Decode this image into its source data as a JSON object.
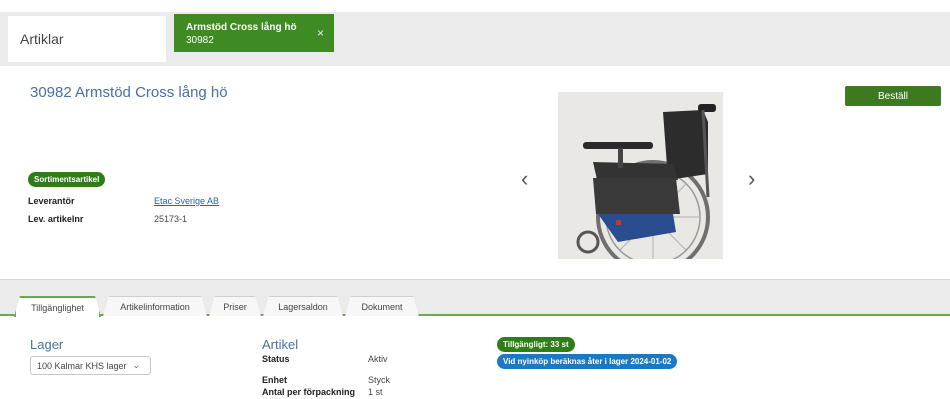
{
  "top_tabs": {
    "plain_label": "Artiklar",
    "active": {
      "title": "Armstöd Cross lång hö",
      "number": "30982",
      "close": "×"
    }
  },
  "product": {
    "title": "30982 Armstöd Cross lång hö",
    "order_button": "Beställ",
    "badge": "Sortimentsartikel",
    "supplier_label": "Leverantör",
    "supplier_value": "Etac Sverige AB",
    "article_no_label": "Lev. artikelnr",
    "article_no_value": "25173-1",
    "prev_arrow": "‹",
    "next_arrow": "›"
  },
  "tabs": [
    {
      "label": "Tillgänglighet"
    },
    {
      "label": "Artikelinformation"
    },
    {
      "label": "Priser"
    },
    {
      "label": "Lagersaldon"
    },
    {
      "label": "Dokument"
    }
  ],
  "lager": {
    "title": "Lager",
    "selected": "100 Kalmar KHS lager",
    "chevron": "⌄"
  },
  "artikel": {
    "title": "Artikel",
    "status_label": "Status",
    "status_value": "Aktiv",
    "unit_label": "Enhet",
    "unit_value": "Styck",
    "pack_label": "Antal per förpackning",
    "pack_value": "1 st"
  },
  "availability": {
    "available": "Tillgängligt: 33 st",
    "restock": "Vid nyinköp beräknas åter i lager  2024-01-02"
  },
  "colors": {
    "brand_green": "#3d8b22",
    "link_blue": "#2a62b5",
    "title_blue": "#4a6fa5",
    "pill_blue": "#1b78c2"
  }
}
